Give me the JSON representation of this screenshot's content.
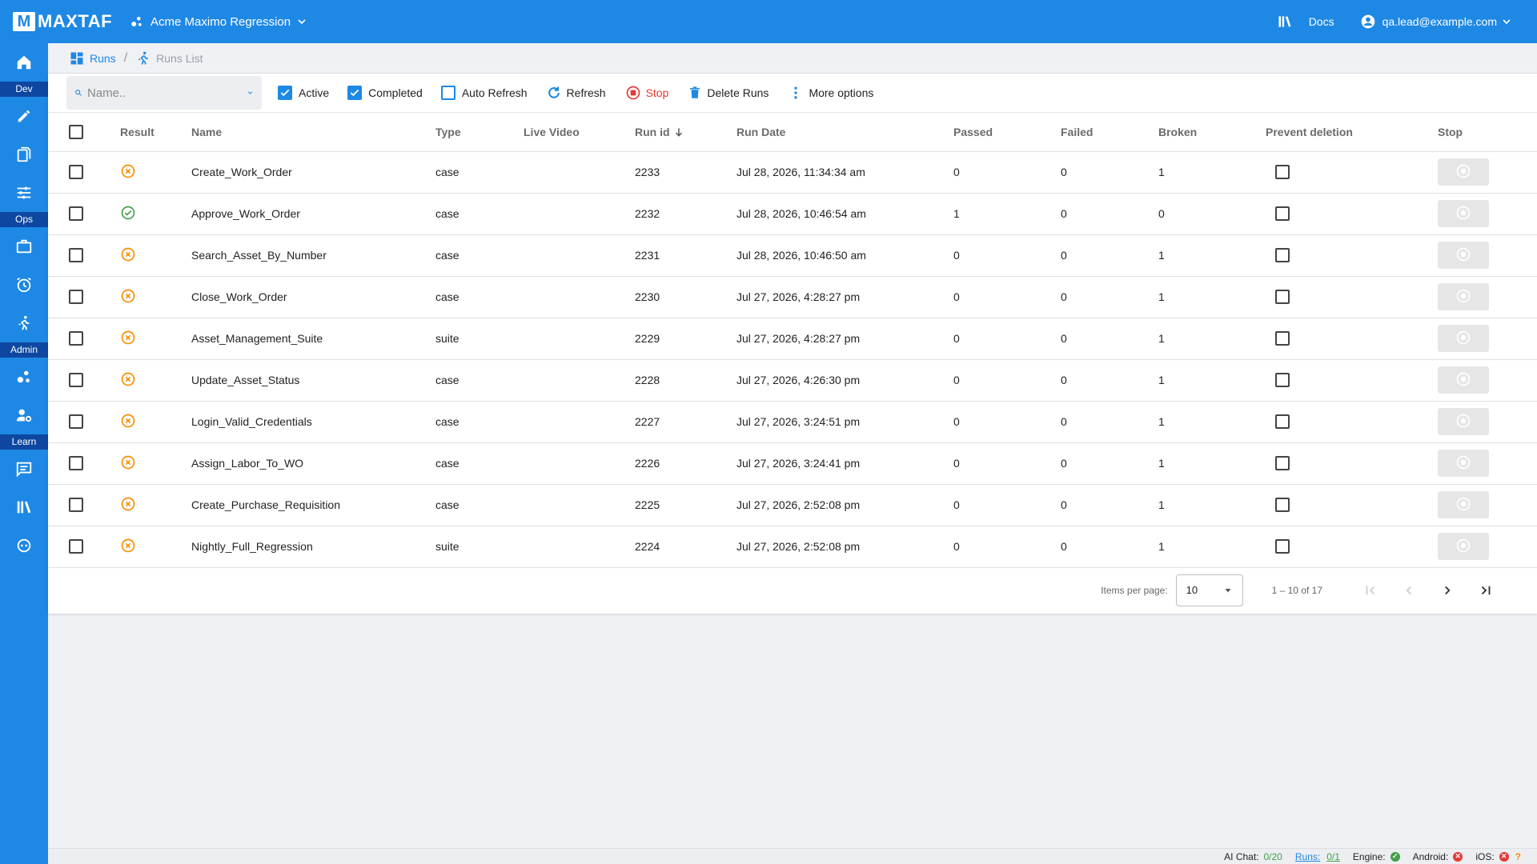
{
  "header": {
    "logo_mark": "M",
    "logo_text": "MAXTAF",
    "project_name": "Acme Maximo Regression",
    "docs_label": "Docs",
    "user_email": "qa.lead@example.com"
  },
  "sidebar": {
    "labels": {
      "dev": "Dev",
      "ops": "Ops",
      "admin": "Admin",
      "learn": "Learn"
    }
  },
  "breadcrumb": {
    "root": "Runs",
    "separator": "/",
    "current": "Runs List"
  },
  "toolbar": {
    "search_placeholder": "Name..",
    "active_label": "Active",
    "active_checked": true,
    "completed_label": "Completed",
    "completed_checked": true,
    "auto_refresh_label": "Auto Refresh",
    "auto_refresh_checked": false,
    "refresh_label": "Refresh",
    "stop_label": "Stop",
    "delete_label": "Delete Runs",
    "more_label": "More options"
  },
  "table": {
    "columns": {
      "result": "Result",
      "name": "Name",
      "type": "Type",
      "live_video": "Live Video",
      "run_id": "Run id",
      "run_date": "Run Date",
      "passed": "Passed",
      "failed": "Failed",
      "broken": "Broken",
      "prevent_deletion": "Prevent deletion",
      "stop": "Stop"
    },
    "rows": [
      {
        "result": "broken",
        "name": "Create_Work_Order",
        "type": "case",
        "run_id": "2233",
        "run_date": "Jul 28, 2026, 11:34:34 am",
        "passed": "0",
        "failed": "0",
        "broken": "1"
      },
      {
        "result": "passed",
        "name": "Approve_Work_Order",
        "type": "case",
        "run_id": "2232",
        "run_date": "Jul 28, 2026, 10:46:54 am",
        "passed": "1",
        "failed": "0",
        "broken": "0"
      },
      {
        "result": "broken",
        "name": "Search_Asset_By_Number",
        "type": "case",
        "run_id": "2231",
        "run_date": "Jul 28, 2026, 10:46:50 am",
        "passed": "0",
        "failed": "0",
        "broken": "1"
      },
      {
        "result": "broken",
        "name": "Close_Work_Order",
        "type": "case",
        "run_id": "2230",
        "run_date": "Jul 27, 2026, 4:28:27 pm",
        "passed": "0",
        "failed": "0",
        "broken": "1"
      },
      {
        "result": "broken",
        "name": "Asset_Management_Suite",
        "type": "suite",
        "run_id": "2229",
        "run_date": "Jul 27, 2026, 4:28:27 pm",
        "passed": "0",
        "failed": "0",
        "broken": "1"
      },
      {
        "result": "broken",
        "name": "Update_Asset_Status",
        "type": "case",
        "run_id": "2228",
        "run_date": "Jul 27, 2026, 4:26:30 pm",
        "passed": "0",
        "failed": "0",
        "broken": "1"
      },
      {
        "result": "broken",
        "name": "Login_Valid_Credentials",
        "type": "case",
        "run_id": "2227",
        "run_date": "Jul 27, 2026, 3:24:51 pm",
        "passed": "0",
        "failed": "0",
        "broken": "1"
      },
      {
        "result": "broken",
        "name": "Assign_Labor_To_WO",
        "type": "case",
        "run_id": "2226",
        "run_date": "Jul 27, 2026, 3:24:41 pm",
        "passed": "0",
        "failed": "0",
        "broken": "1"
      },
      {
        "result": "broken",
        "name": "Create_Purchase_Requisition",
        "type": "case",
        "run_id": "2225",
        "run_date": "Jul 27, 2026, 2:52:08 pm",
        "passed": "0",
        "failed": "0",
        "broken": "1"
      },
      {
        "result": "broken",
        "name": "Nightly_Full_Regression",
        "type": "suite",
        "run_id": "2224",
        "run_date": "Jul 27, 2026, 2:52:08 pm",
        "passed": "0",
        "failed": "0",
        "broken": "1"
      }
    ]
  },
  "paginator": {
    "items_per_page_label": "Items per page:",
    "items_per_page_value": "10",
    "range_label": "1 – 10 of 17"
  },
  "statusbar": {
    "ai_chat_label": "AI Chat:",
    "ai_chat_value": "0/20",
    "runs_label": "Runs:",
    "runs_value": "0/1",
    "engine_label": "Engine:",
    "android_label": "Android:",
    "ios_label": "iOS:"
  },
  "colors": {
    "primary": "#1e88e5",
    "sidebar_label_bg": "#0d47a1",
    "broken": "#fb8c00",
    "passed": "#43a047",
    "stop": "#e53935"
  }
}
